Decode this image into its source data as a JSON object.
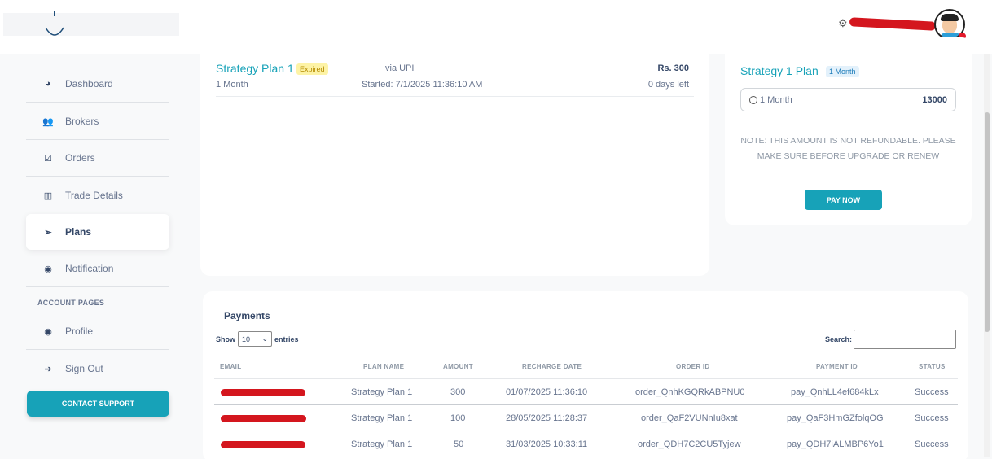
{
  "sidebar": {
    "items": [
      {
        "label": "Dashboard",
        "icon": "dashboard-icon"
      },
      {
        "label": "Brokers",
        "icon": "users-icon"
      },
      {
        "label": "Orders",
        "icon": "calendar-check-icon"
      },
      {
        "label": "Trade Details",
        "icon": "bar-chart-icon"
      },
      {
        "label": "Plans",
        "icon": "paper-plane-icon"
      },
      {
        "label": "Notification",
        "icon": "user-circle-icon"
      }
    ],
    "section_heading": "ACCOUNT PAGES",
    "account_items": [
      {
        "label": "Profile",
        "icon": "user-circle-icon"
      },
      {
        "label": "Sign Out",
        "icon": "sign-out-icon"
      }
    ],
    "support_label": "CONTACT SUPPORT"
  },
  "current_plan": {
    "name": "Strategy Plan 1",
    "status_badge": "Expired",
    "duration": "1 Month",
    "via": "via UPI",
    "started": "Started: 7/1/2025 11:36:10 AM",
    "price": "Rs. 300",
    "days_left": "0 days left"
  },
  "upgrade": {
    "title": "Strategy 1 Plan",
    "badge": "1 Month",
    "option_label": "1 Month",
    "option_price": "13000",
    "note": "NOTE: THIS AMOUNT IS NOT REFUNDABLE. PLEASE MAKE SURE BEFORE UPGRADE OR RENEW",
    "pay_label": "PAY NOW"
  },
  "payments": {
    "title": "Payments",
    "show_label": "Show",
    "entries_label": "entries",
    "page_size": "10",
    "search_label": "Search:",
    "columns": [
      "EMAIL",
      "PLAN NAME",
      "AMOUNT",
      "RECHARGE DATE",
      "ORDER ID",
      "PAYMENT ID",
      "STATUS"
    ],
    "rows": [
      {
        "plan": "Strategy Plan 1",
        "amount": "300",
        "date": "01/07/2025 11:36:10",
        "order_id": "order_QnhKGQRkABPNU0",
        "payment_id": "pay_QnhLL4ef684kLx",
        "status": "Success"
      },
      {
        "plan": "Strategy Plan 1",
        "amount": "100",
        "date": "28/05/2025 11:28:37",
        "order_id": "order_QaF2VUNnIu8xat",
        "payment_id": "pay_QaF3HmGZfolqOG",
        "status": "Success"
      },
      {
        "plan": "Strategy Plan 1",
        "amount": "50",
        "date": "31/03/2025 10:33:11",
        "order_id": "order_QDH7C2CU5Tyjew",
        "payment_id": "pay_QDH7iALMBP6Yo1",
        "status": "Success"
      }
    ]
  },
  "colors": {
    "accent": "#17a2b8",
    "redaction": "#d4161e",
    "expired_badge": "#fdf3a6"
  }
}
